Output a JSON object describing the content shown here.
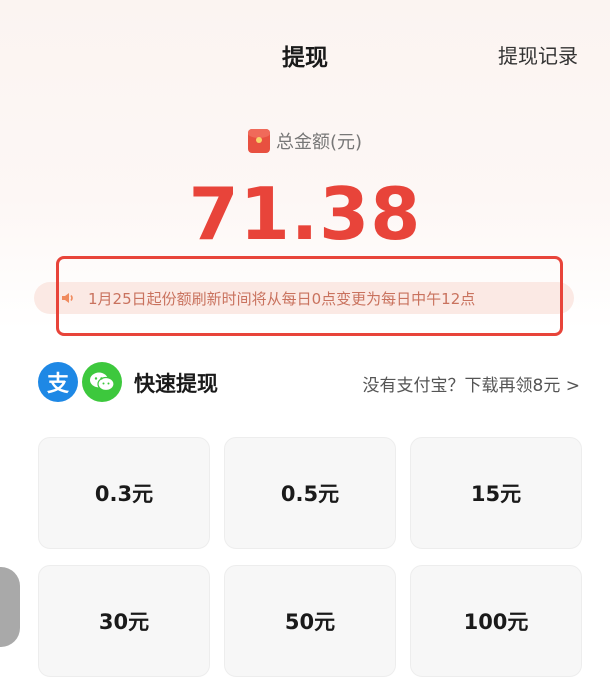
{
  "header": {
    "title": "提现",
    "history_link": "提现记录"
  },
  "balance": {
    "label": "总金额(元)",
    "amount": "71.38",
    "icon": "red-envelope-icon"
  },
  "notice": {
    "icon": "speaker-icon",
    "text": "1月25日起份额刷新时间将从每日0点变更为每日中午12点"
  },
  "quick_withdraw": {
    "alipay_icon_char": "支",
    "title": "快速提现",
    "promo": "没有支付宝？下载再领8元 >"
  },
  "amount_options": [
    {
      "label": "0.3元"
    },
    {
      "label": "0.5元"
    },
    {
      "label": "15元"
    },
    {
      "label": "30元"
    },
    {
      "label": "50元"
    },
    {
      "label": "100元"
    }
  ],
  "colors": {
    "accent_red": "#e8443a",
    "alipay_blue": "#1e88e5",
    "wechat_green": "#3dc83d"
  }
}
